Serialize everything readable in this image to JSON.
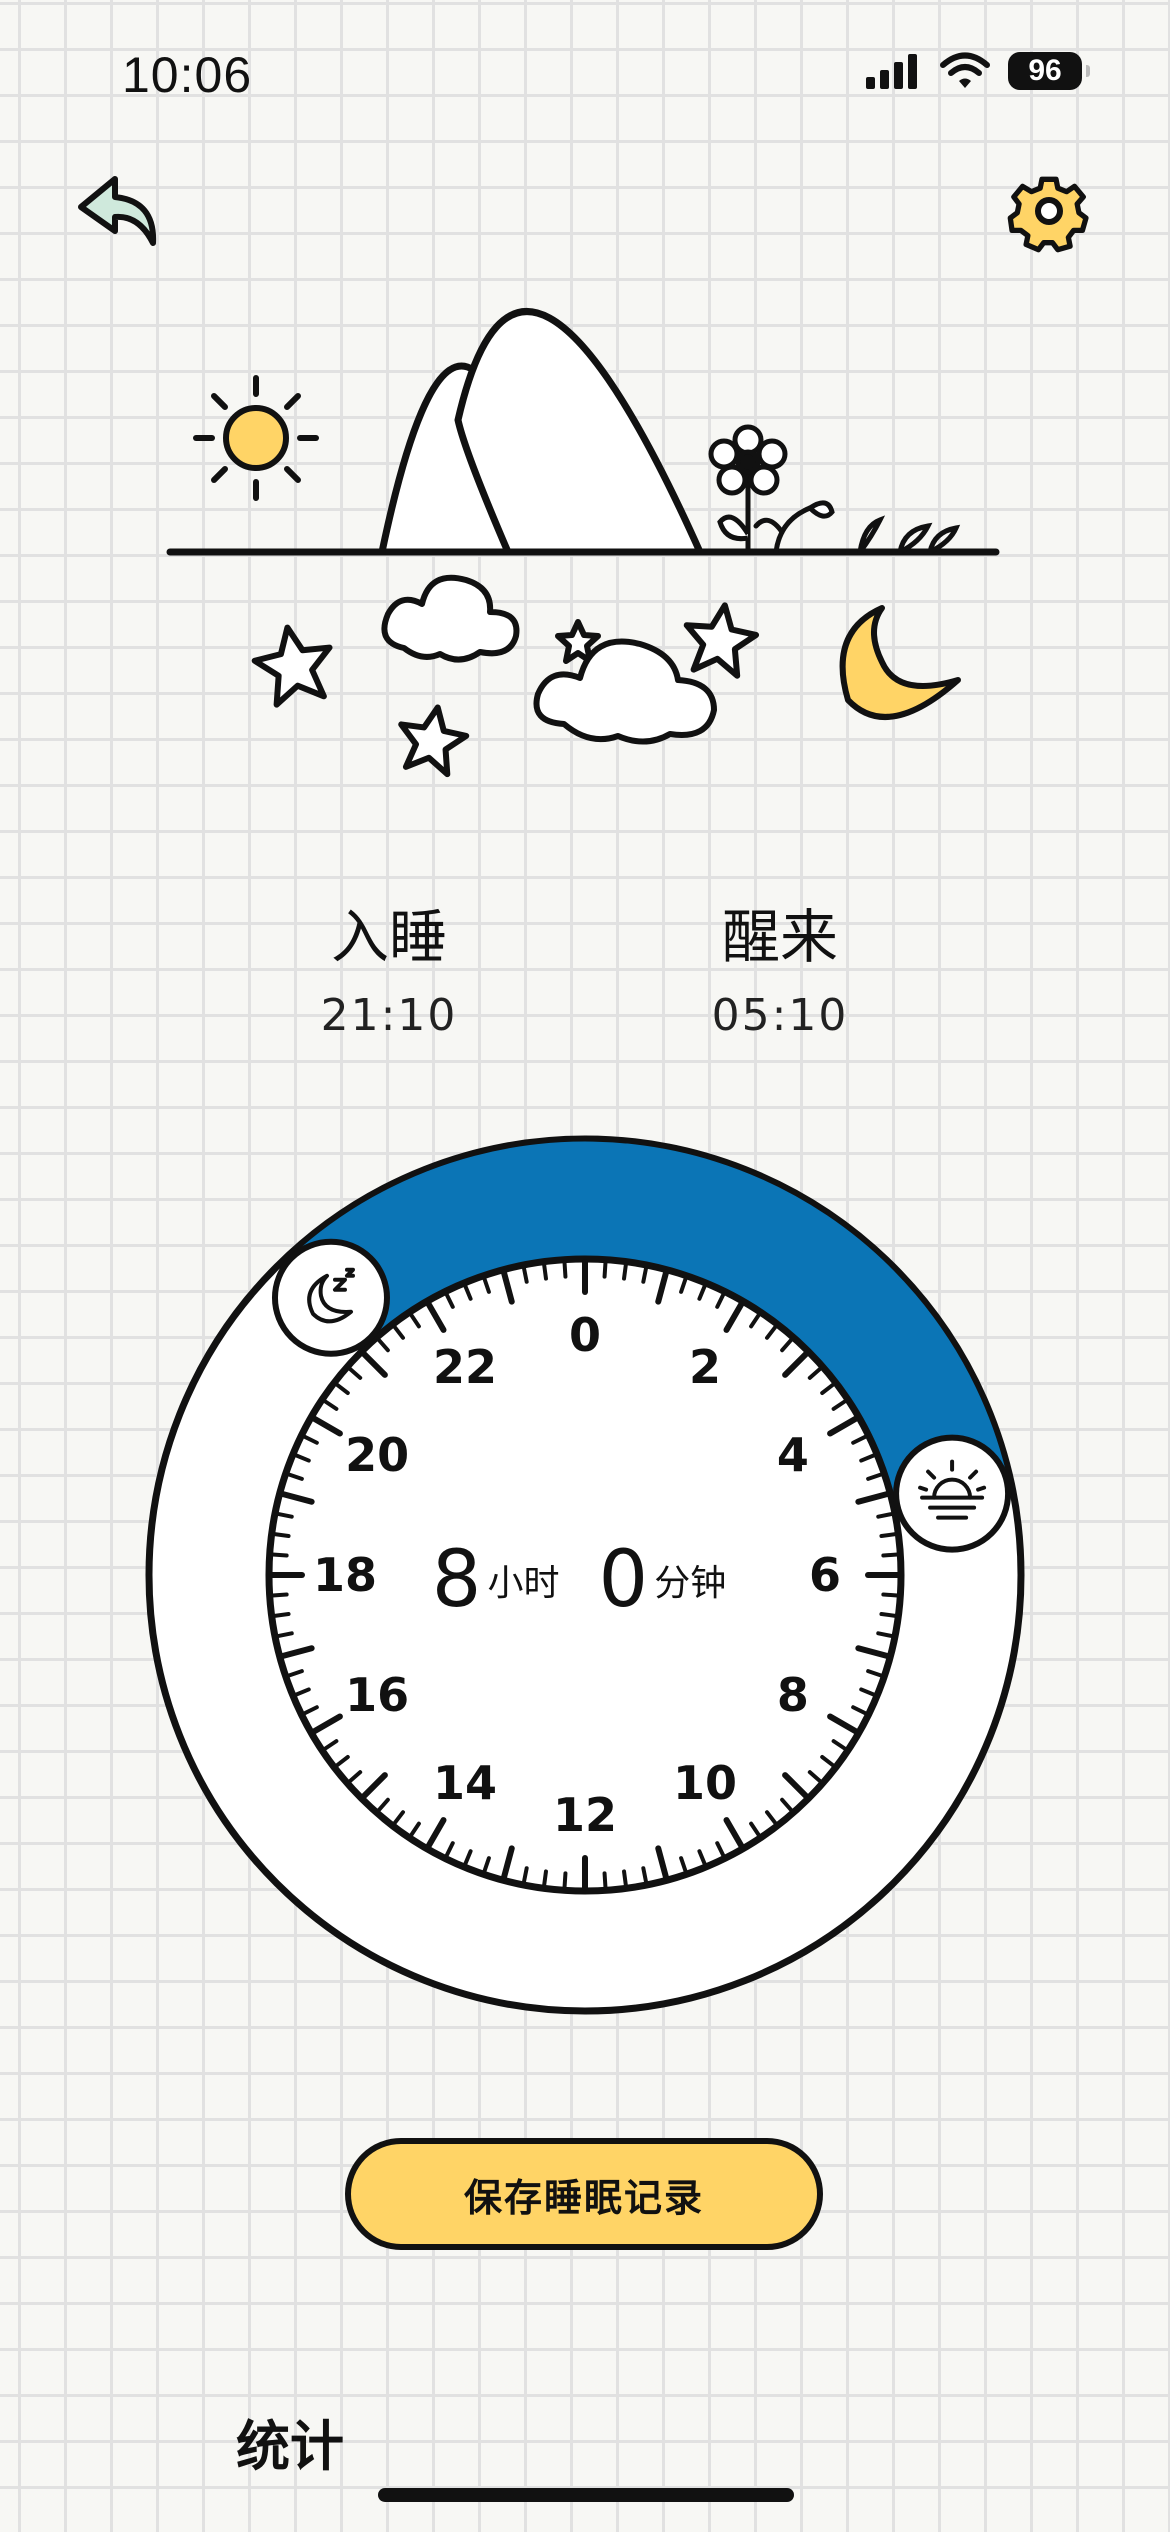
{
  "status_bar": {
    "time": "10:06",
    "battery": "96",
    "icons": [
      "signal-icon",
      "wifi-icon",
      "battery-icon"
    ]
  },
  "header": {
    "back_icon": "back-arrow-icon",
    "settings_icon": "gear-icon"
  },
  "sleep": {
    "bedtime_label": "入睡",
    "bedtime_value": "21:10",
    "wake_label": "醒来",
    "wake_value": "05:10"
  },
  "dial": {
    "hour_labels": [
      "0",
      "2",
      "4",
      "6",
      "8",
      "10",
      "12",
      "14",
      "16",
      "18",
      "20",
      "22"
    ],
    "start_hour": 21.1667,
    "end_hour": 5.1667,
    "arc_color": "#0b75b6",
    "duration_hours": "8",
    "hours_unit": "小时",
    "duration_minutes": "0",
    "minutes_unit": "分钟",
    "start_icon": "moon-sleep-icon",
    "end_icon": "sunrise-icon"
  },
  "actions": {
    "save_label": "保存睡眠记录",
    "save_color": "#ffd466"
  },
  "stats": {
    "title": "统计"
  },
  "colors": {
    "accent_yellow": "#ffd466",
    "icon_mint": "#cfe9dc"
  }
}
